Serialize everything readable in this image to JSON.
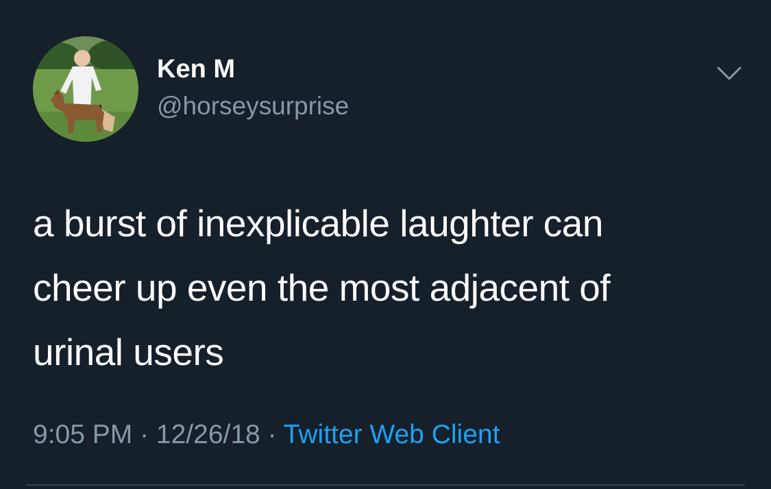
{
  "user": {
    "display_name": "Ken M",
    "handle": "@horseysurprise",
    "avatar_icon": "profile-photo-man-with-pony"
  },
  "tweet": {
    "text": "a burst of inexplicable laughter can\ncheer up even the most adjacent of\nurinal users",
    "time": "9:05 PM",
    "separator": " · ",
    "date": "12/26/18",
    "source": "Twitter Web Client"
  },
  "menu": {
    "icon": "chevron-down-icon"
  },
  "colors": {
    "background": "#15202b",
    "text_primary": "#ffffff",
    "text_secondary": "#8899a6",
    "link": "#1da1f2",
    "divider": "#38444d"
  }
}
